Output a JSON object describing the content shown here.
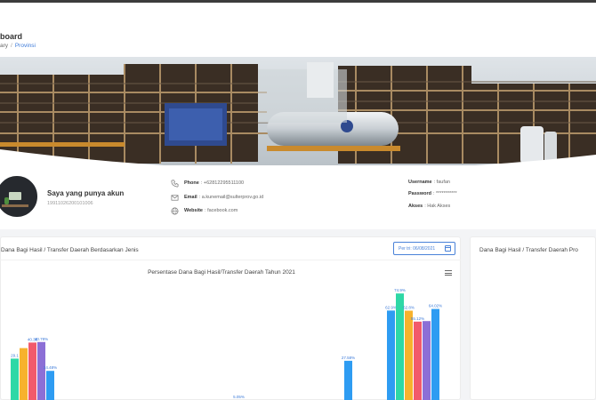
{
  "header": {
    "title": "board",
    "breadcrumb": [
      "ary",
      "Provinsi"
    ]
  },
  "profile": {
    "name": "Saya yang punya akun",
    "id_number": "19911026200101006",
    "contacts": [
      {
        "icon": "phone-icon",
        "label": "Phone",
        "value": "+62812295511100"
      },
      {
        "icon": "mail-icon",
        "label": "Email",
        "value": "a.kunemail@sulterprov.go.id"
      },
      {
        "icon": "globe-icon",
        "label": "Website",
        "value": "facebook.com"
      }
    ],
    "account": [
      {
        "label": "Username",
        "value": "faufan"
      },
      {
        "label": "Password",
        "value": "***********"
      },
      {
        "label": "Akses",
        "value": "Hak Akses"
      }
    ]
  },
  "panel_left": {
    "title": "Dana Bagi Hasil / Transfer Daerah Berdasarkan Jenis",
    "date_filter": "Per tri: 06/08/2021"
  },
  "panel_right": {
    "title": "Dana Bagi Hasil / Transfer Daerah Pro"
  },
  "chart_data": {
    "type": "bar",
    "title": "Persentase Dana Bagi Hasil/Transfer Daerah Tahun 2021",
    "colors": [
      "#2ed8a6",
      "#f7b22d",
      "#f25a6b",
      "#8c6fd6",
      "#2e9cf2"
    ],
    "groups": [
      {
        "values": [
          29.1,
          36.5,
          40.38,
          40.78,
          20.48
        ],
        "labels": [
          "29.1",
          "",
          "40.38",
          "40.78%",
          "24.48%"
        ]
      },
      {
        "values": [
          0.02,
          0,
          0,
          0,
          0
        ],
        "labels": [
          "5.05%",
          "",
          "",
          "",
          ""
        ]
      },
      {
        "values": [
          0,
          0,
          0,
          0,
          27.58
        ],
        "labels": [
          "",
          "",
          "",
          "",
          "27.58%"
        ]
      },
      {
        "values": [
          62.9,
          74.9,
          62.8,
          55.12,
          55.5,
          64.02
        ],
        "labels": [
          "62.9%",
          "74.9%",
          "62.8%",
          "55.12%",
          "",
          "64.02%"
        ]
      }
    ],
    "ylim": [
      0,
      80
    ]
  }
}
